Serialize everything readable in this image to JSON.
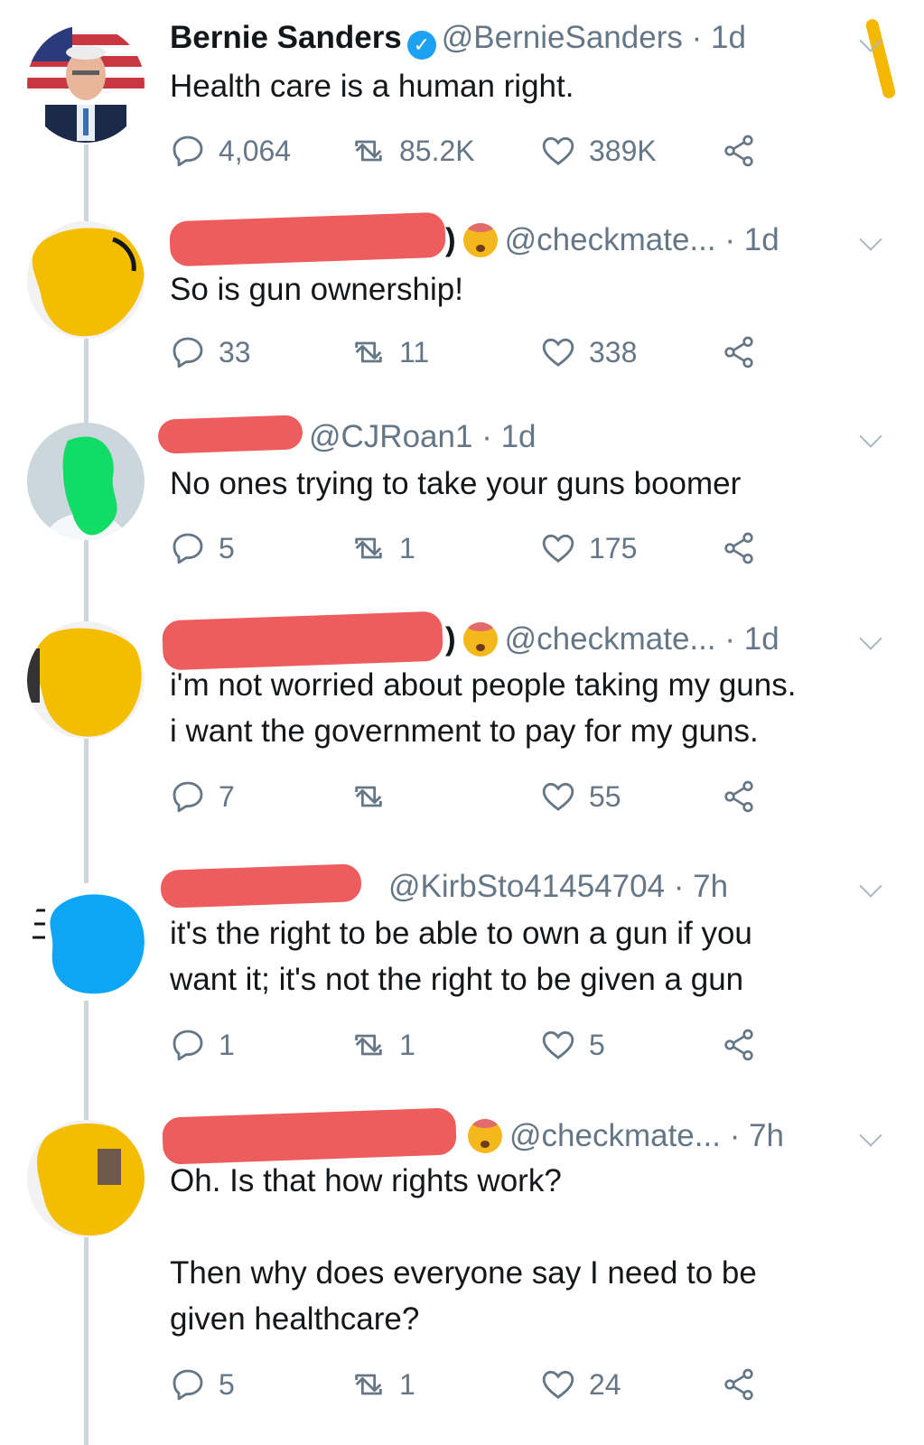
{
  "tweets": [
    {
      "display_name": "Bernie Sanders",
      "handle": "@BernieSanders",
      "time": "· 1d",
      "text": "Health care is a human right.",
      "replies": "4,064",
      "retweets": "85.2K",
      "likes": "389K"
    },
    {
      "display_name": "",
      "name_suffix": ")",
      "handle": "@checkmate...",
      "time": "· 1d",
      "text": "So is gun ownership!",
      "replies": "33",
      "retweets": "11",
      "likes": "338"
    },
    {
      "display_name": "",
      "handle": "@CJRoan1",
      "time": "· 1d",
      "text": "No ones trying to take your guns boomer",
      "replies": "5",
      "retweets": "1",
      "likes": "175"
    },
    {
      "display_name": "",
      "name_suffix": ")",
      "handle": "@checkmate...",
      "time": "· 1d",
      "text": "i'm not worried about people taking my guns.\ni want the government to pay for my guns.",
      "replies": "7",
      "retweets": "",
      "likes": "55"
    },
    {
      "display_name": "",
      "handle": "@KirbSto41454704",
      "time": "· 7h",
      "text": "it's the right to be able to own a gun if you\nwant it; it's not the right to be given a gun",
      "replies": "1",
      "retweets": "1",
      "likes": "5"
    },
    {
      "display_name": "",
      "handle": "@checkmate...",
      "time": "· 7h",
      "text": "Oh. Is that how rights work?\n\nThen why does everyone say I need to be\ngiven healthcare?",
      "replies": "5",
      "retweets": "1",
      "likes": "24"
    }
  ],
  "icons": {
    "reply": "reply-icon",
    "retweet": "retweet-icon",
    "like": "heart-icon",
    "share": "share-icon",
    "verified": "verified-badge-icon",
    "emoji": "exploding-head-emoji-icon",
    "more": "chevron-down-icon"
  },
  "colors": {
    "icon_gray": "#657786",
    "redaction": "#ee5d5d",
    "verified_blue": "#1da1f2",
    "thread_line": "#ccd6dd"
  }
}
